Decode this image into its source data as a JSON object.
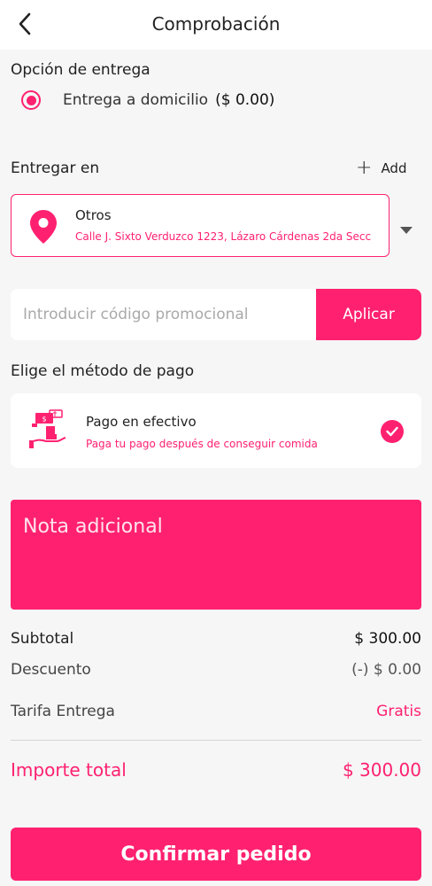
{
  "header": {
    "title": "Comprobación",
    "back_icon": "chevron-left-icon"
  },
  "delivery_option": {
    "label": "Opción de entrega",
    "choice_label": "Entrega a domicilio",
    "choice_price": "($ 0.00)",
    "selected": true
  },
  "deliver_to": {
    "label": "Entregar en",
    "add_label": "Add",
    "address_name": "Otros",
    "address_line": "Calle J. Sixto Verduzco 1223, Lázaro Cárdenas 2da Secc",
    "icon": "location-pin-icon"
  },
  "promo": {
    "placeholder": "Introducir código promocional",
    "value": "",
    "apply_label": "Aplicar"
  },
  "payment": {
    "label": "Elige el método de pago",
    "method_name": "Pago en efectivo",
    "method_desc": "Paga tu pago después de conseguir comida",
    "icon": "cash-payment-icon",
    "selected": true
  },
  "note": {
    "placeholder": "Nota adicional"
  },
  "summary": {
    "subtotal_label": "Subtotal",
    "subtotal_value": "$ 300.00",
    "discount_label": "Descuento",
    "discount_value": "(-) $ 0.00",
    "delivery_fee_label": "Tarifa Entrega",
    "delivery_fee_value": "Gratis",
    "total_label": "Importe total",
    "total_value": "$ 300.00"
  },
  "confirm_label": "Confirmar pedido",
  "colors": {
    "accent": "#ff2170",
    "background": "#f6f6f6"
  }
}
